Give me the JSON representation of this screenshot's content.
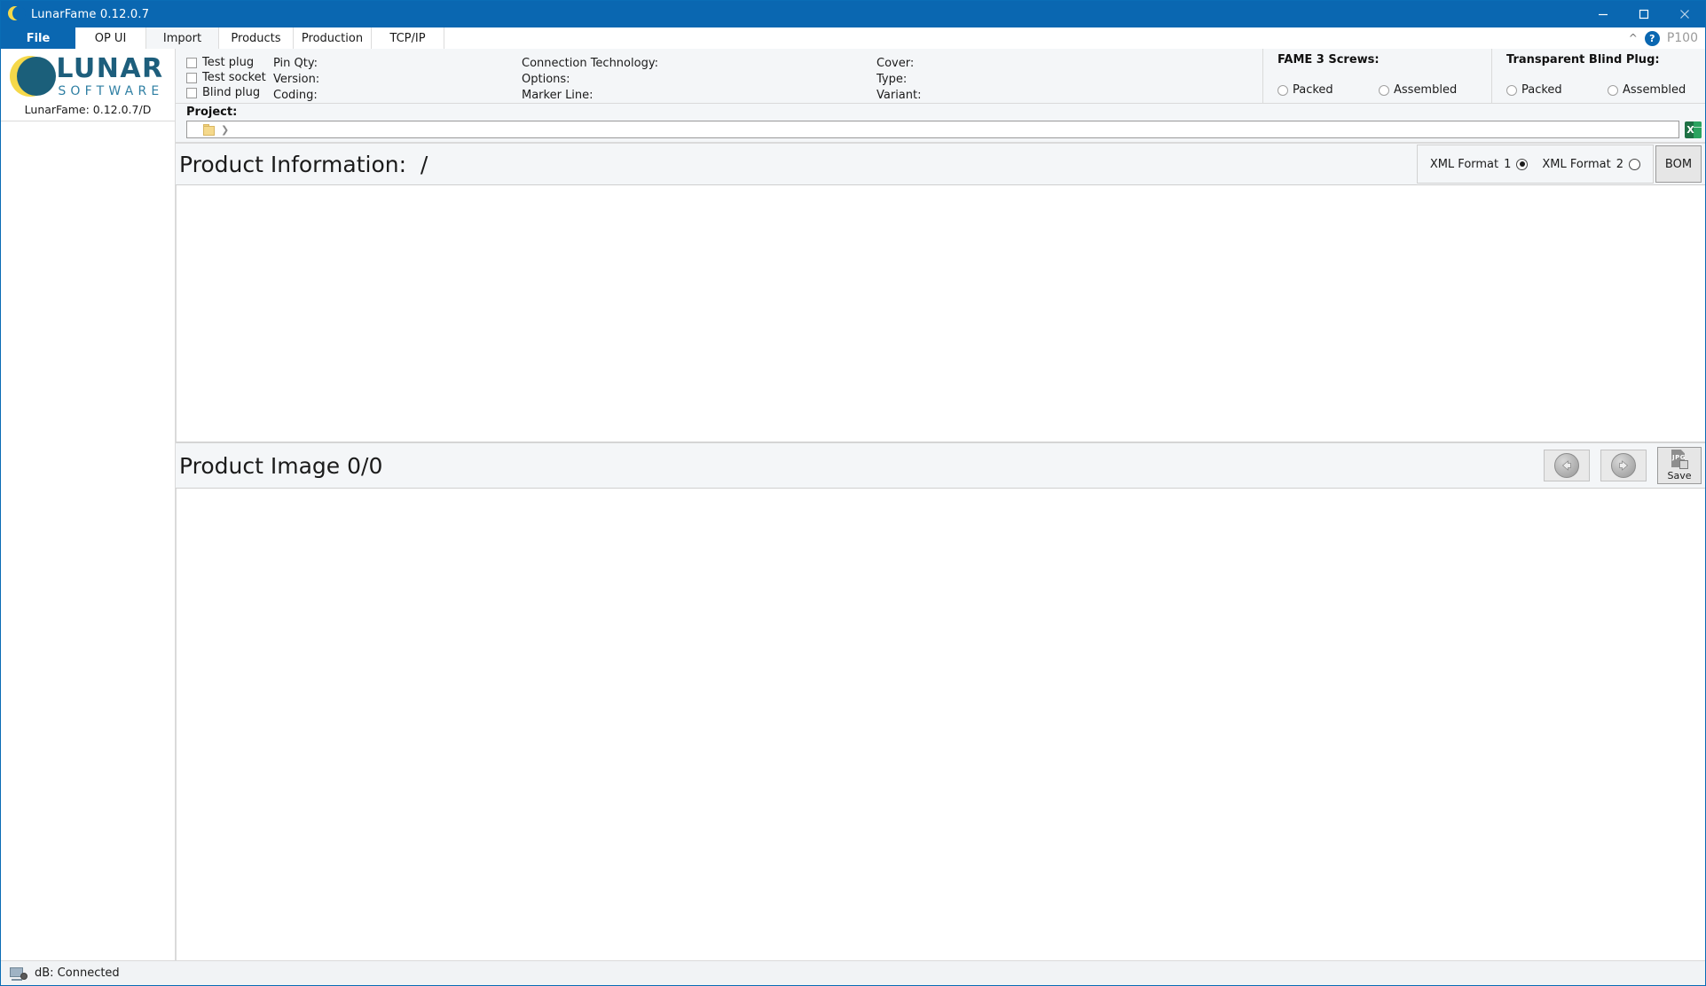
{
  "window": {
    "title": "LunarFame 0.12.0.7",
    "app_icon": "moon-icon",
    "minimize_label": "—",
    "maximize_label": "□",
    "close_label": "✕"
  },
  "tabs": [
    {
      "label": "File",
      "selected": false,
      "accent": true
    },
    {
      "label": "OP UI",
      "selected": false
    },
    {
      "label": "Import",
      "selected": true
    },
    {
      "label": "Products",
      "selected": false
    },
    {
      "label": "Production",
      "selected": false
    },
    {
      "label": "TCP/IP",
      "selected": false
    }
  ],
  "tabstrip_right": {
    "collapse_icon": "chevron-up-icon",
    "help_label": "?",
    "page_code": "P100"
  },
  "branding": {
    "logo_primary": "LUNAR",
    "logo_secondary": "SOFTWARE",
    "version_text": "LunarFame: 0.12.0.7/D",
    "logo_yellow": "#f5d84a",
    "logo_teal": "#1d5e7c"
  },
  "form": {
    "checkboxes": [
      {
        "label": "Test plug",
        "checked": false
      },
      {
        "label": "Test socket",
        "checked": false
      },
      {
        "label": "Blind plug",
        "checked": false
      }
    ],
    "fields_col1": [
      {
        "label": "Pin Qty:",
        "value": ""
      },
      {
        "label": "Version:",
        "value": ""
      },
      {
        "label": "Coding:",
        "value": ""
      }
    ],
    "fields_col2": [
      {
        "label": "Connection Technology:",
        "value": ""
      },
      {
        "label": "Options:",
        "value": ""
      },
      {
        "label": "Marker Line:",
        "value": ""
      }
    ],
    "fields_col3": [
      {
        "label": "Cover:",
        "value": ""
      },
      {
        "label": "Type:",
        "value": ""
      },
      {
        "label": "Variant:",
        "value": ""
      }
    ],
    "fame_screws": {
      "title": "FAME 3 Screws:",
      "options": [
        {
          "label": "Packed",
          "selected": false
        },
        {
          "label": "Assembled",
          "selected": false
        }
      ]
    },
    "transparent_blind_plug": {
      "title": "Transparent Blind Plug:",
      "options": [
        {
          "label": "Packed",
          "selected": false
        },
        {
          "label": "Assembled",
          "selected": false
        }
      ]
    }
  },
  "project": {
    "label": "Project:",
    "tree_value": "",
    "folder_icon": "folder-icon",
    "expander_glyph": "❯",
    "excel_icon": "excel-export-icon",
    "excel_glyph": "X"
  },
  "product_information": {
    "title": "Product Information:  /",
    "xml_format_1": {
      "label": "XML Format",
      "number": "1",
      "selected": true
    },
    "xml_format_2": {
      "label": "XML Format",
      "number": "2",
      "selected": false
    },
    "bom_label": "BOM"
  },
  "product_image": {
    "title": "Product Image 0/0",
    "prev_icon": "arrow-left-icon",
    "next_icon": "arrow-right-icon",
    "save_label": "Save",
    "save_icon": "save-jpg-icon",
    "save_icon_text": "JPG"
  },
  "status": {
    "icon": "database-connection-icon",
    "text": "dB: Connected"
  }
}
